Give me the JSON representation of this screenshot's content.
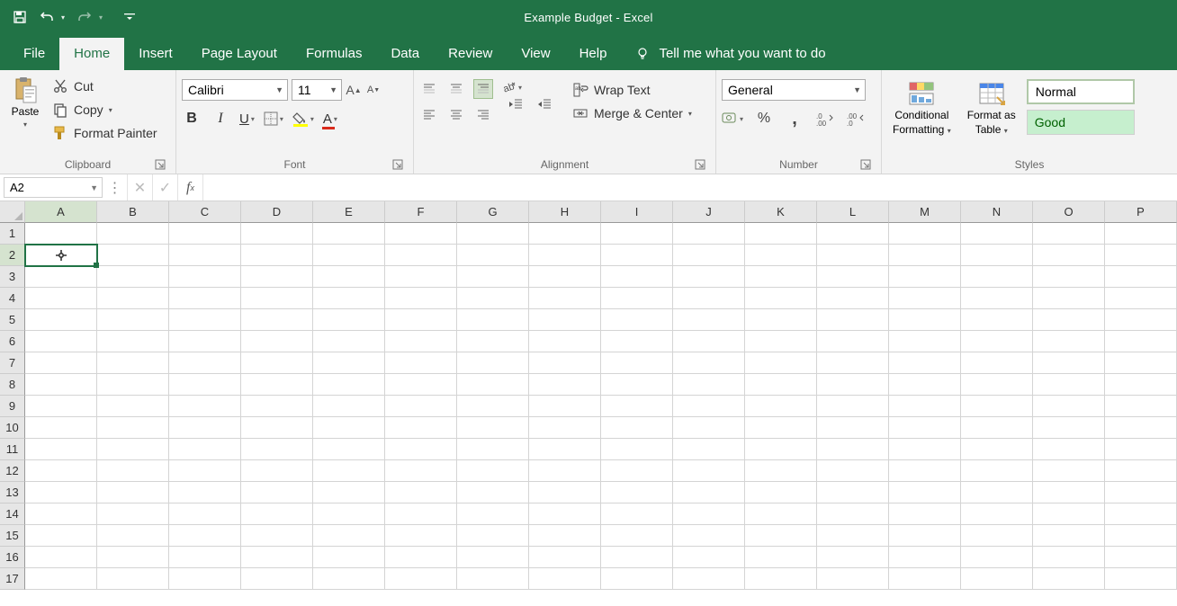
{
  "title": {
    "doc": "Example Budget",
    "sep": "  -  ",
    "app": "Excel"
  },
  "tabs": {
    "file": "File",
    "home": "Home",
    "insert": "Insert",
    "page_layout": "Page Layout",
    "formulas": "Formulas",
    "data": "Data",
    "review": "Review",
    "view": "View",
    "help": "Help",
    "tellme": "Tell me what you want to do"
  },
  "ribbon": {
    "clipboard": {
      "label": "Clipboard",
      "paste": "Paste",
      "cut": "Cut",
      "copy": "Copy",
      "format_painter": "Format Painter"
    },
    "font": {
      "label": "Font",
      "name": "Calibri",
      "size": "11"
    },
    "alignment": {
      "label": "Alignment",
      "wrap": "Wrap Text",
      "merge": "Merge & Center"
    },
    "number": {
      "label": "Number",
      "format": "General"
    },
    "styles": {
      "label": "Styles",
      "conditional1": "Conditional",
      "conditional2": "Formatting",
      "tablefmt1": "Format as",
      "tablefmt2": "Table",
      "normal": "Normal",
      "good": "Good"
    }
  },
  "formula_bar": {
    "namebox": "A2",
    "formula": ""
  },
  "grid": {
    "columns": [
      "A",
      "B",
      "C",
      "D",
      "E",
      "F",
      "G",
      "H",
      "I",
      "J",
      "K",
      "L",
      "M",
      "N",
      "O",
      "P"
    ],
    "rows": [
      1,
      2,
      3,
      4,
      5,
      6,
      7,
      8,
      9,
      10,
      11,
      12,
      13,
      14,
      15,
      16,
      17
    ],
    "selected": {
      "col": "A",
      "row": 2
    }
  }
}
